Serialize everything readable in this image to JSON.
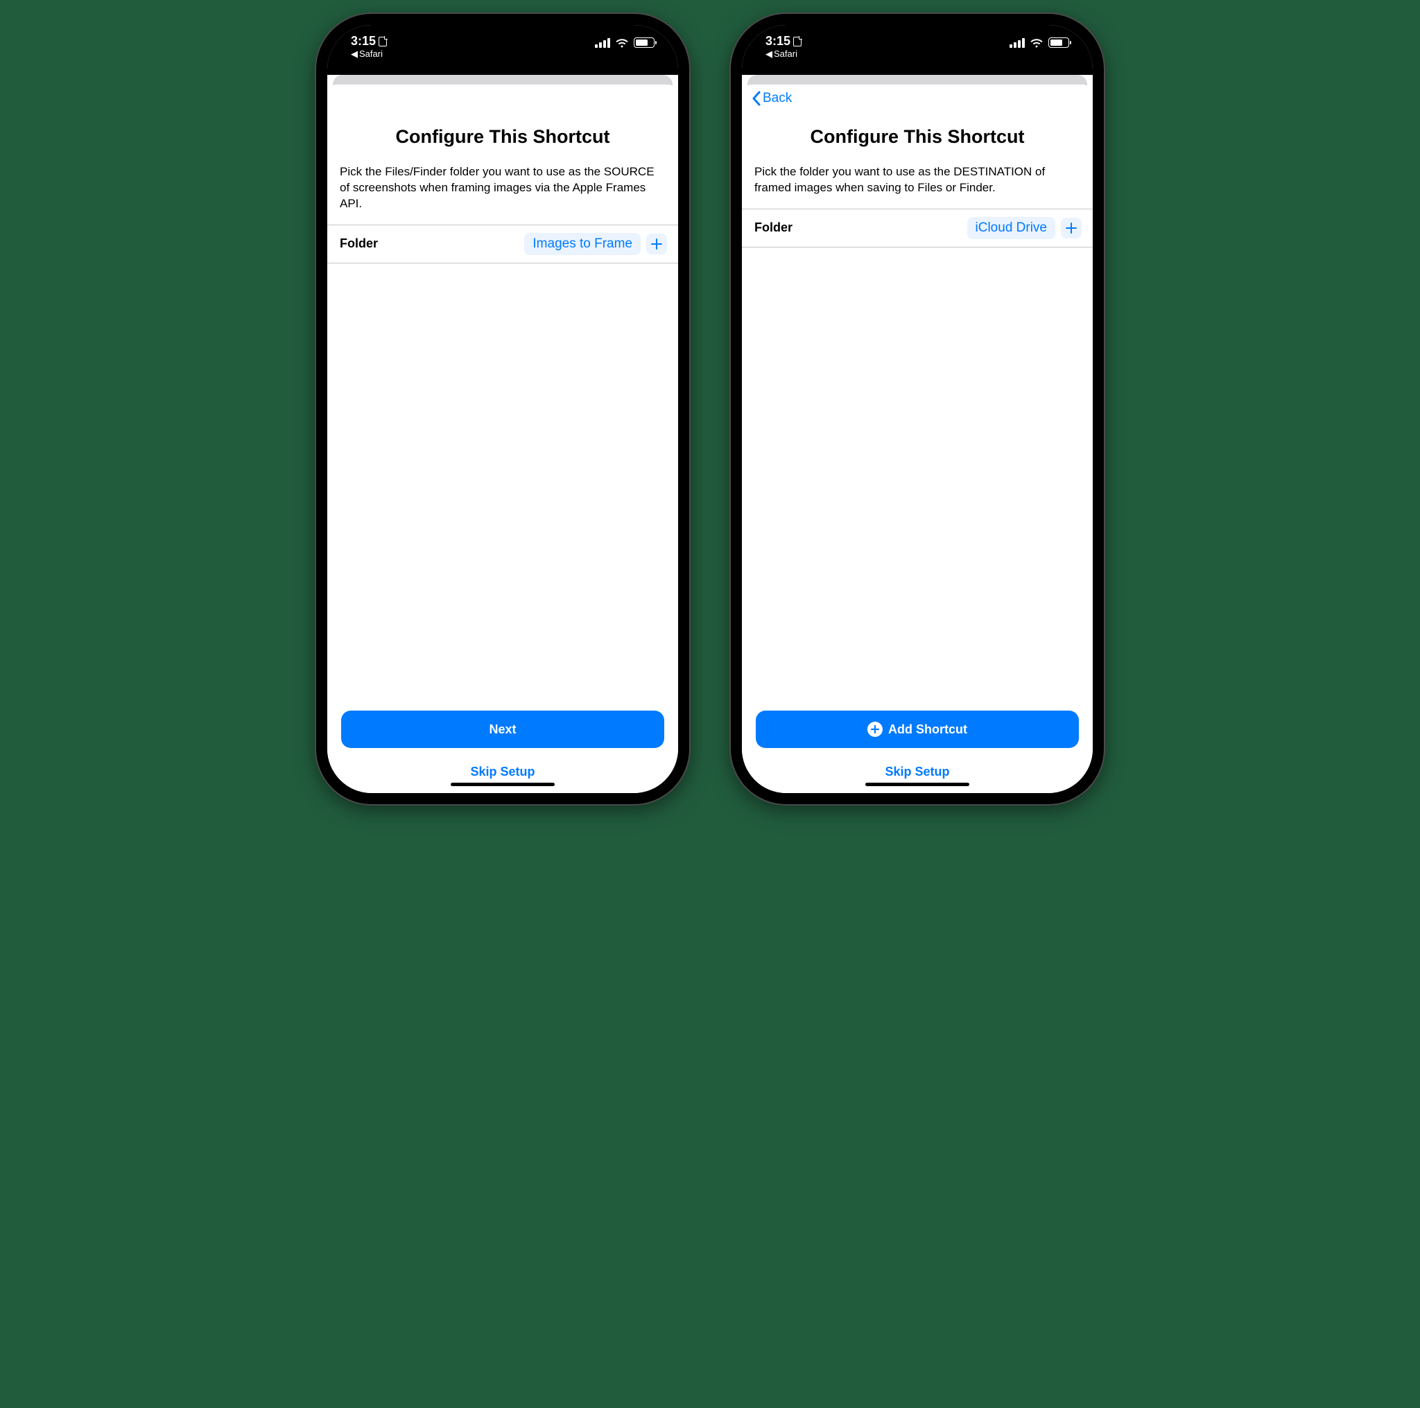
{
  "status": {
    "time": "3:15",
    "breadcrumb_app": "Safari"
  },
  "left": {
    "title": "Configure This Shortcut",
    "description": "Pick the Files/Finder folder you want to use as the SOURCE of screenshots when framing images via the Apple Frames API.",
    "row_label": "Folder",
    "row_value": "Images to Frame",
    "primary_button": "Next",
    "secondary_button": "Skip Setup"
  },
  "right": {
    "back_label": "Back",
    "title": "Configure This Shortcut",
    "description": "Pick the folder you want to use as the DESTINATION of framed images when saving to Files or Finder.",
    "row_label": "Folder",
    "row_value": "iCloud Drive",
    "primary_button": "Add Shortcut",
    "secondary_button": "Skip Setup"
  }
}
